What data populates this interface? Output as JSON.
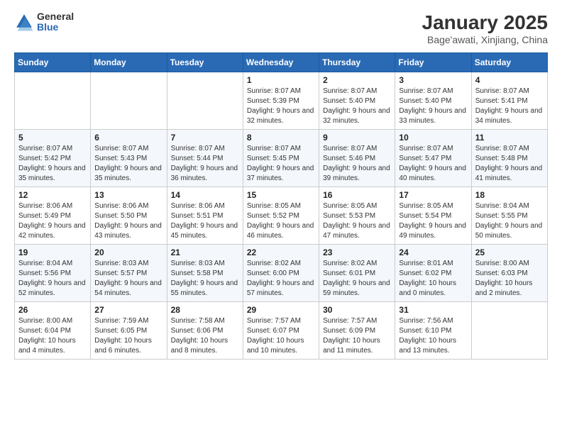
{
  "logo": {
    "general": "General",
    "blue": "Blue"
  },
  "title": "January 2025",
  "subtitle": "Bage'awati, Xinjiang, China",
  "header_days": [
    "Sunday",
    "Monday",
    "Tuesday",
    "Wednesday",
    "Thursday",
    "Friday",
    "Saturday"
  ],
  "weeks": [
    [
      {
        "date": "",
        "info": ""
      },
      {
        "date": "",
        "info": ""
      },
      {
        "date": "",
        "info": ""
      },
      {
        "date": "1",
        "info": "Sunrise: 8:07 AM\nSunset: 5:39 PM\nDaylight: 9 hours and 32 minutes."
      },
      {
        "date": "2",
        "info": "Sunrise: 8:07 AM\nSunset: 5:40 PM\nDaylight: 9 hours and 32 minutes."
      },
      {
        "date": "3",
        "info": "Sunrise: 8:07 AM\nSunset: 5:40 PM\nDaylight: 9 hours and 33 minutes."
      },
      {
        "date": "4",
        "info": "Sunrise: 8:07 AM\nSunset: 5:41 PM\nDaylight: 9 hours and 34 minutes."
      }
    ],
    [
      {
        "date": "5",
        "info": "Sunrise: 8:07 AM\nSunset: 5:42 PM\nDaylight: 9 hours and 35 minutes."
      },
      {
        "date": "6",
        "info": "Sunrise: 8:07 AM\nSunset: 5:43 PM\nDaylight: 9 hours and 35 minutes."
      },
      {
        "date": "7",
        "info": "Sunrise: 8:07 AM\nSunset: 5:44 PM\nDaylight: 9 hours and 36 minutes."
      },
      {
        "date": "8",
        "info": "Sunrise: 8:07 AM\nSunset: 5:45 PM\nDaylight: 9 hours and 37 minutes."
      },
      {
        "date": "9",
        "info": "Sunrise: 8:07 AM\nSunset: 5:46 PM\nDaylight: 9 hours and 39 minutes."
      },
      {
        "date": "10",
        "info": "Sunrise: 8:07 AM\nSunset: 5:47 PM\nDaylight: 9 hours and 40 minutes."
      },
      {
        "date": "11",
        "info": "Sunrise: 8:07 AM\nSunset: 5:48 PM\nDaylight: 9 hours and 41 minutes."
      }
    ],
    [
      {
        "date": "12",
        "info": "Sunrise: 8:06 AM\nSunset: 5:49 PM\nDaylight: 9 hours and 42 minutes."
      },
      {
        "date": "13",
        "info": "Sunrise: 8:06 AM\nSunset: 5:50 PM\nDaylight: 9 hours and 43 minutes."
      },
      {
        "date": "14",
        "info": "Sunrise: 8:06 AM\nSunset: 5:51 PM\nDaylight: 9 hours and 45 minutes."
      },
      {
        "date": "15",
        "info": "Sunrise: 8:05 AM\nSunset: 5:52 PM\nDaylight: 9 hours and 46 minutes."
      },
      {
        "date": "16",
        "info": "Sunrise: 8:05 AM\nSunset: 5:53 PM\nDaylight: 9 hours and 47 minutes."
      },
      {
        "date": "17",
        "info": "Sunrise: 8:05 AM\nSunset: 5:54 PM\nDaylight: 9 hours and 49 minutes."
      },
      {
        "date": "18",
        "info": "Sunrise: 8:04 AM\nSunset: 5:55 PM\nDaylight: 9 hours and 50 minutes."
      }
    ],
    [
      {
        "date": "19",
        "info": "Sunrise: 8:04 AM\nSunset: 5:56 PM\nDaylight: 9 hours and 52 minutes."
      },
      {
        "date": "20",
        "info": "Sunrise: 8:03 AM\nSunset: 5:57 PM\nDaylight: 9 hours and 54 minutes."
      },
      {
        "date": "21",
        "info": "Sunrise: 8:03 AM\nSunset: 5:58 PM\nDaylight: 9 hours and 55 minutes."
      },
      {
        "date": "22",
        "info": "Sunrise: 8:02 AM\nSunset: 6:00 PM\nDaylight: 9 hours and 57 minutes."
      },
      {
        "date": "23",
        "info": "Sunrise: 8:02 AM\nSunset: 6:01 PM\nDaylight: 9 hours and 59 minutes."
      },
      {
        "date": "24",
        "info": "Sunrise: 8:01 AM\nSunset: 6:02 PM\nDaylight: 10 hours and 0 minutes."
      },
      {
        "date": "25",
        "info": "Sunrise: 8:00 AM\nSunset: 6:03 PM\nDaylight: 10 hours and 2 minutes."
      }
    ],
    [
      {
        "date": "26",
        "info": "Sunrise: 8:00 AM\nSunset: 6:04 PM\nDaylight: 10 hours and 4 minutes."
      },
      {
        "date": "27",
        "info": "Sunrise: 7:59 AM\nSunset: 6:05 PM\nDaylight: 10 hours and 6 minutes."
      },
      {
        "date": "28",
        "info": "Sunrise: 7:58 AM\nSunset: 6:06 PM\nDaylight: 10 hours and 8 minutes."
      },
      {
        "date": "29",
        "info": "Sunrise: 7:57 AM\nSunset: 6:07 PM\nDaylight: 10 hours and 10 minutes."
      },
      {
        "date": "30",
        "info": "Sunrise: 7:57 AM\nSunset: 6:09 PM\nDaylight: 10 hours and 11 minutes."
      },
      {
        "date": "31",
        "info": "Sunrise: 7:56 AM\nSunset: 6:10 PM\nDaylight: 10 hours and 13 minutes."
      },
      {
        "date": "",
        "info": ""
      }
    ]
  ]
}
